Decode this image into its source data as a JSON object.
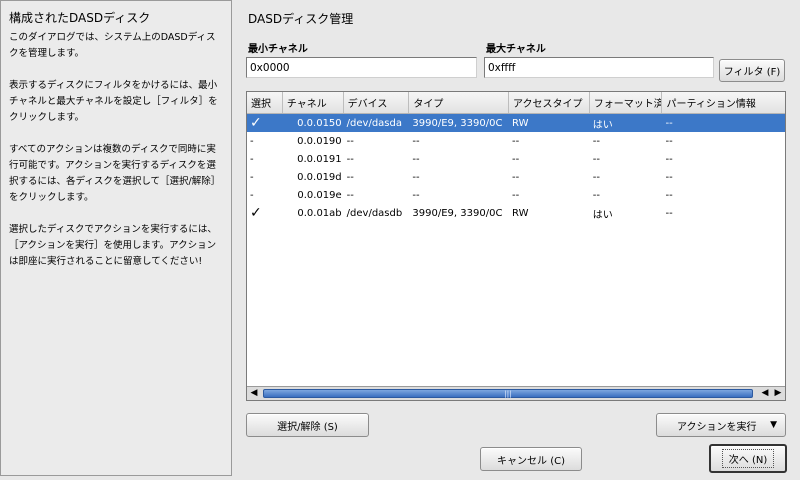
{
  "help": {
    "title": "構成されたDASDディスク",
    "paragraphs": [
      "このダイアログでは、システム上のDASDディスクを管理します。",
      "表示するディスクにフィルタをかけるには、最小チャネルと最大チャネルを設定し［フィルタ］をクリックします。",
      "すべてのアクションは複数のディスクで同時に実行可能です。アクションを実行するディスクを選択するには、各ディスクを選択して［選択/解除］をクリックします。",
      "選択したディスクでアクションを実行するには、［アクションを実行］を使用します。アクションは即座に実行されることに留意してください!"
    ]
  },
  "main": {
    "title": "DASDディスク管理",
    "min_channel_label": "最小チャネル",
    "min_channel_value": "0x0000",
    "max_channel_label": "最大チャネル",
    "max_channel_value": "0xffff",
    "filter_button": "フィルタ (F)"
  },
  "table": {
    "columns": [
      "選択",
      "チャネル",
      "デバイス",
      "タイプ",
      "アクセスタイプ",
      "フォーマット済",
      "パーティション情報"
    ],
    "rows": [
      {
        "select": "✓",
        "channel": "0.0.0150",
        "device": "/dev/dasda",
        "type": "3990/E9, 3390/0C",
        "access": "RW",
        "formatted": "はい",
        "partition": "--"
      },
      {
        "select": "-",
        "channel": "0.0.0190",
        "device": "--",
        "type": "--",
        "access": "--",
        "formatted": "--",
        "partition": "--"
      },
      {
        "select": "-",
        "channel": "0.0.0191",
        "device": "--",
        "type": "--",
        "access": "--",
        "formatted": "--",
        "partition": "--"
      },
      {
        "select": "-",
        "channel": "0.0.019d",
        "device": "--",
        "type": "--",
        "access": "--",
        "formatted": "--",
        "partition": "--"
      },
      {
        "select": "-",
        "channel": "0.0.019e",
        "device": "--",
        "type": "--",
        "access": "--",
        "formatted": "--",
        "partition": "--"
      },
      {
        "select": "✓",
        "channel": "0.0.01ab",
        "device": "/dev/dasdb",
        "type": "3990/E9, 3390/0C",
        "access": "RW",
        "formatted": "はい",
        "partition": "--"
      }
    ]
  },
  "buttons": {
    "select_toggle": "選択/解除 (S)",
    "perform_action": "アクションを実行",
    "cancel": "キャンセル (C)",
    "next": "次へ (N)"
  },
  "colors": {
    "selection": "#3c78c8",
    "background": "#e8e8e8"
  }
}
